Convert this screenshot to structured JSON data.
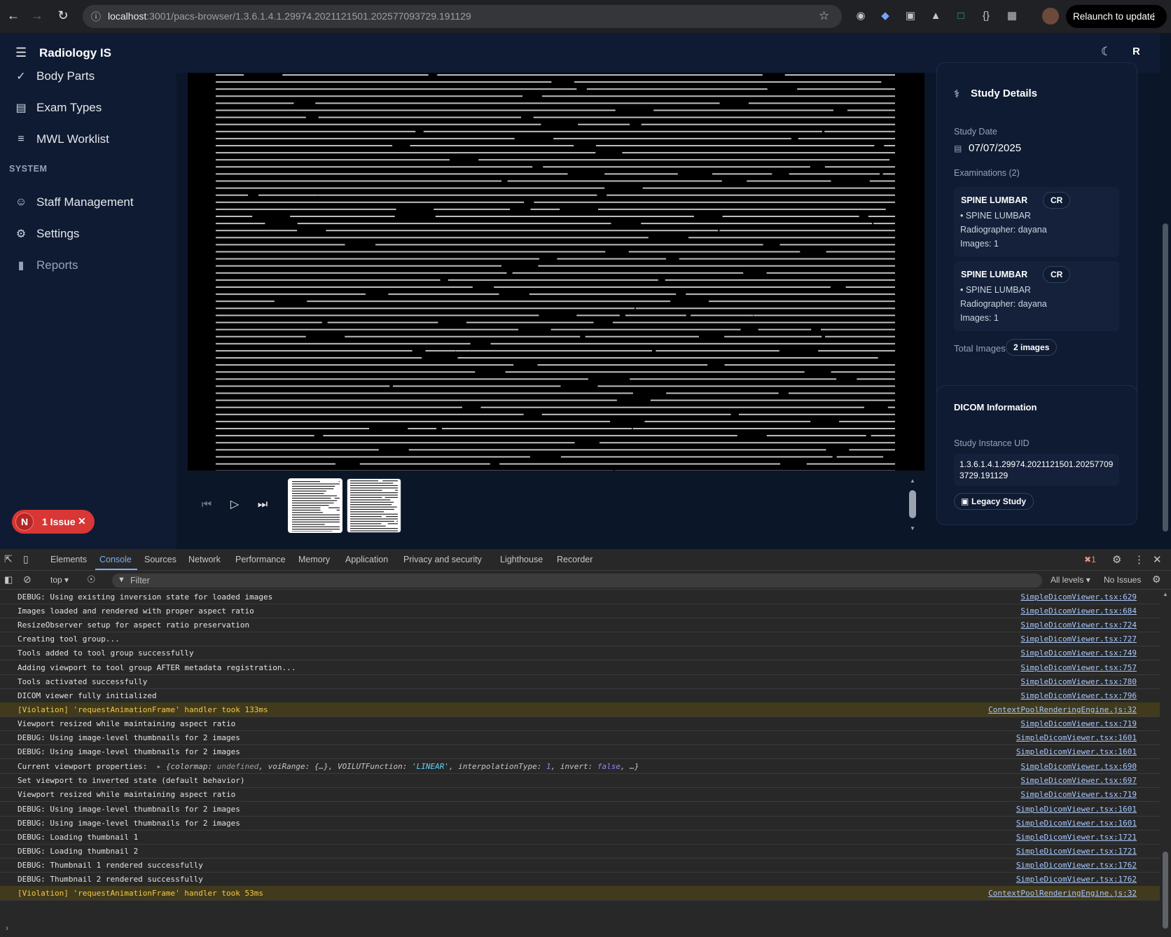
{
  "browser": {
    "url_host": "localhost",
    "url_rest": ":3001/pacs-browser/1.3.6.1.4.1.29974.2021121501.202577093729.191129",
    "relaunch_label": "Relaunch to update",
    "profile_initial": ""
  },
  "app": {
    "title": "Radiology IS",
    "user_initial": "R"
  },
  "sidebar": {
    "items": [
      {
        "label": "Body Parts",
        "icon": "body-parts-icon"
      },
      {
        "label": "Exam Types",
        "icon": "document-icon"
      },
      {
        "label": "MWL Worklist",
        "icon": "list-icon"
      }
    ],
    "section_label": "SYSTEM",
    "system_items": [
      {
        "label": "Staff Management",
        "icon": "users-icon"
      },
      {
        "label": "Settings",
        "icon": "gear-icon"
      },
      {
        "label": "Reports",
        "icon": "bar-chart-icon"
      }
    ]
  },
  "study_details": {
    "title": "Study Details",
    "study_date_label": "Study Date",
    "study_date": "07/07/2025",
    "examinations_label": "Examinations (2)",
    "exams": [
      {
        "name": "SPINE LUMBAR",
        "modality": "CR",
        "body_part": "• SPINE LUMBAR",
        "radiographer": "Radiographer: dayana",
        "images": "Images: 1"
      },
      {
        "name": "SPINE LUMBAR",
        "modality": "CR",
        "body_part": "• SPINE LUMBAR",
        "radiographer": "Radiographer: dayana",
        "images": "Images: 1"
      }
    ],
    "total_images_label": "Total Images",
    "total_images": "2 images"
  },
  "dicom": {
    "title": "DICOM Information",
    "uid_label": "Study Instance UID",
    "uid_line1": "1.3.6.1.4.1.29974.2021121501.20257709",
    "uid_line2": "3729.191129",
    "legacy_label": "Legacy Study"
  },
  "issue_badge": {
    "initial": "N",
    "label": "1 Issue"
  },
  "devtools": {
    "tabs": [
      "Elements",
      "Console",
      "Sources",
      "Network",
      "Performance",
      "Memory",
      "Application",
      "Privacy and security",
      "Lighthouse",
      "Recorder"
    ],
    "active_tab": "Console",
    "error_count": "1",
    "context": "top",
    "filter_placeholder": "Filter",
    "levels": "All levels",
    "issues": "No Issues",
    "logs": [
      {
        "msg": "DEBUG: Using existing inversion state for loaded images",
        "src": "SimpleDicomViewer.tsx:629",
        "level": "log"
      },
      {
        "msg": "Images loaded and rendered with proper aspect ratio",
        "src": "SimpleDicomViewer.tsx:684",
        "level": "log"
      },
      {
        "msg": "ResizeObserver setup for aspect ratio preservation",
        "src": "SimpleDicomViewer.tsx:724",
        "level": "log"
      },
      {
        "msg": "Creating tool group...",
        "src": "SimpleDicomViewer.tsx:727",
        "level": "log"
      },
      {
        "msg": "Tools added to tool group successfully",
        "src": "SimpleDicomViewer.tsx:749",
        "level": "log"
      },
      {
        "msg": "Adding viewport to tool group AFTER metadata registration...",
        "src": "SimpleDicomViewer.tsx:757",
        "level": "log"
      },
      {
        "msg": "Tools activated successfully",
        "src": "SimpleDicomViewer.tsx:780",
        "level": "log"
      },
      {
        "msg": "DICOM viewer fully initialized",
        "src": "SimpleDicomViewer.tsx:796",
        "level": "log"
      },
      {
        "msg": "[Violation] 'requestAnimationFrame' handler took 133ms",
        "src": "ContextPoolRenderingEngine.js:32",
        "level": "warn"
      },
      {
        "msg": "Viewport resized while maintaining aspect ratio",
        "src": "SimpleDicomViewer.tsx:719",
        "level": "log"
      },
      {
        "msg": "DEBUG: Using image-level thumbnails for 2 images",
        "src": "SimpleDicomViewer.tsx:1601",
        "level": "log"
      },
      {
        "msg": "DEBUG: Using image-level thumbnails for 2 images",
        "src": "SimpleDicomViewer.tsx:1601",
        "level": "log"
      },
      {
        "msg": "Current viewport properties: ",
        "src": "SimpleDicomViewer.tsx:690",
        "level": "obj"
      },
      {
        "msg": "Set viewport to inverted state (default behavior)",
        "src": "SimpleDicomViewer.tsx:697",
        "level": "log"
      },
      {
        "msg": "Viewport resized while maintaining aspect ratio",
        "src": "SimpleDicomViewer.tsx:719",
        "level": "log"
      },
      {
        "msg": "DEBUG: Using image-level thumbnails for 2 images",
        "src": "SimpleDicomViewer.tsx:1601",
        "level": "log"
      },
      {
        "msg": "DEBUG: Using image-level thumbnails for 2 images",
        "src": "SimpleDicomViewer.tsx:1601",
        "level": "log"
      },
      {
        "msg": "DEBUG: Loading thumbnail 1",
        "src": "SimpleDicomViewer.tsx:1721",
        "level": "log"
      },
      {
        "msg": "DEBUG: Loading thumbnail 2",
        "src": "SimpleDicomViewer.tsx:1721",
        "level": "log"
      },
      {
        "msg": "DEBUG: Thumbnail 1 rendered successfully",
        "src": "SimpleDicomViewer.tsx:1762",
        "level": "log"
      },
      {
        "msg": "DEBUG: Thumbnail 2 rendered successfully",
        "src": "SimpleDicomViewer.tsx:1762",
        "level": "log"
      },
      {
        "msg": "[Violation] 'requestAnimationFrame' handler took 53ms",
        "src": "ContextPoolRenderingEngine.js:32",
        "level": "warn"
      }
    ],
    "obj_preview": {
      "colormap_key": "colormap",
      "colormap_val": "undefined",
      "voi_key": "voiRange",
      "voi_val": "{…}",
      "func_key": "VOILUTFunction",
      "func_val": "'LINEAR'",
      "interp_key": "interpolationType",
      "interp_val": "1",
      "invert_key": "invert",
      "invert_val": "false"
    }
  },
  "colors": {
    "app_bg": "#0c1629",
    "panel_bg": "#0f1b33",
    "accent_link": "#a8c7fa",
    "warn_bg": "#413a1c",
    "issue_red": "#d93636"
  }
}
